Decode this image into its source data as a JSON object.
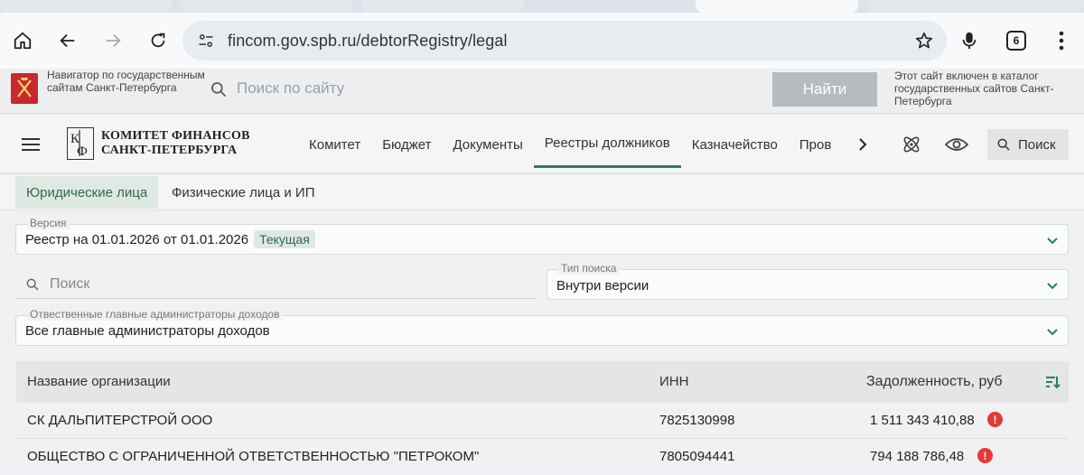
{
  "browser": {
    "url": "fincom.gov.spb.ru/debtorRegistry/legal",
    "tabs_count": "6"
  },
  "govbar": {
    "navigator_text": "Навигатор по государственным сайтам Санкт-Петербурга",
    "search_placeholder": "Поиск по сайту",
    "find_button": "Найти",
    "catalog_text": "Этот сайт включен в каталог государственных сайтов Санкт-Петербурга"
  },
  "site": {
    "logo_line1": "КОМИТЕТ ФИНАНСОВ",
    "logo_line2": "САНКТ-ПЕТЕРБУРГА",
    "nav": [
      {
        "label": "Комитет"
      },
      {
        "label": "Бюджет"
      },
      {
        "label": "Документы"
      },
      {
        "label": "Реестры должников"
      },
      {
        "label": "Казначейство"
      },
      {
        "label": "Пров"
      }
    ],
    "search_button": "Поиск"
  },
  "subtabs": [
    {
      "label": "Юридические лица"
    },
    {
      "label": "Физические лица и ИП"
    }
  ],
  "filters": {
    "version_label": "Версия",
    "version_value": "Реестр на 01.01.2026 от 01.01.2026",
    "version_badge": "Текущая",
    "search_placeholder": "Поиск",
    "search_type_label": "Тип поиска",
    "search_type_value": "Внутри версии",
    "admins_label": "Отвественные главные администраторы доходов",
    "admins_value": "Все главные администраторы доходов"
  },
  "table": {
    "headers": {
      "name": "Название организации",
      "inn": "ИНН",
      "debt": "Задолженность, руб"
    },
    "rows": [
      {
        "name": "СК ДАЛЬПИТЕРСТРОЙ ООО",
        "inn": "7825130998",
        "debt": "1 511 343 410,88"
      },
      {
        "name": "ОБЩЕСТВО С ОГРАНИЧЕННОЙ ОТВЕТСТВЕННОСТЬЮ \"ПЕТРОКОМ\"",
        "inn": "7805094441",
        "debt": "794 188 786,48"
      }
    ]
  },
  "colors": {
    "accent": "#2e7d5b",
    "warning": "#e53935",
    "emblem": "#c8282e"
  }
}
